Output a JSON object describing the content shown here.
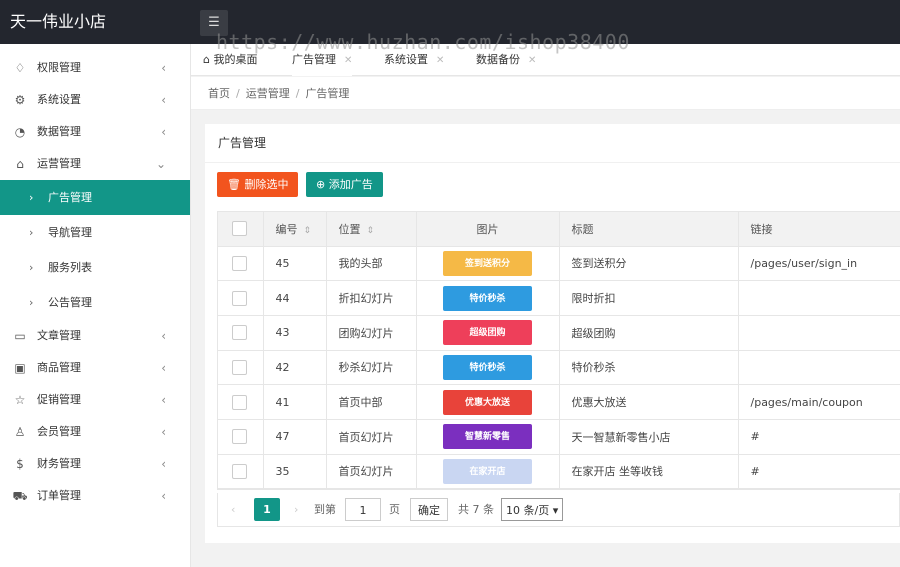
{
  "app": {
    "title": "天一伟业小店",
    "menu_icon": "hamburger-icon"
  },
  "watermark": "https://www.huzhan.com/ishop38400",
  "sidebar": {
    "items": [
      {
        "label": "权限管理",
        "icon": "permissions-icon",
        "glyph": "♢"
      },
      {
        "label": "系统设置",
        "icon": "gear-icon",
        "glyph": "⚙"
      },
      {
        "label": "数据管理",
        "icon": "chart-icon",
        "glyph": "◔"
      },
      {
        "label": "运营管理",
        "icon": "operations-icon",
        "glyph": "⌂",
        "expanded": true
      }
    ],
    "sub_items": [
      {
        "label": "广告管理",
        "active": true
      },
      {
        "label": "导航管理"
      },
      {
        "label": "服务列表"
      },
      {
        "label": "公告管理"
      }
    ],
    "items_after": [
      {
        "label": "文章管理",
        "icon": "book-icon",
        "glyph": "▭"
      },
      {
        "label": "商品管理",
        "icon": "box-icon",
        "glyph": "▣"
      },
      {
        "label": "促销管理",
        "icon": "star-icon",
        "glyph": "☆"
      },
      {
        "label": "会员管理",
        "icon": "user-icon",
        "glyph": "♙"
      },
      {
        "label": "财务管理",
        "icon": "dollar-icon",
        "glyph": "$"
      },
      {
        "label": "订单管理",
        "icon": "cart-icon",
        "glyph": "⛟"
      }
    ]
  },
  "tabs": [
    {
      "label": "我的桌面",
      "icon": "home-icon"
    },
    {
      "label": "广告管理",
      "active": true
    },
    {
      "label": "系统设置"
    },
    {
      "label": "数据备份"
    }
  ],
  "breadcrumb": [
    "首页",
    "运营管理",
    "广告管理"
  ],
  "card": {
    "title": "广告管理",
    "delete_button": "删除选中",
    "add_button": "添加广告"
  },
  "table": {
    "headers": [
      "编号",
      "位置",
      "图片",
      "标题",
      "链接"
    ],
    "rows": [
      {
        "id": "45",
        "position": "我的头部",
        "image_text": "签到送积分",
        "image_color": "#f5b946",
        "title": "签到送积分",
        "link": "/pages/user/sign_in"
      },
      {
        "id": "44",
        "position": "折扣幻灯片",
        "image_text": "特价秒杀",
        "image_color": "#2e9be0",
        "title": "限时折扣",
        "link": ""
      },
      {
        "id": "43",
        "position": "团购幻灯片",
        "image_text": "超级团购",
        "image_color": "#ee3f5a",
        "title": "超级团购",
        "link": ""
      },
      {
        "id": "42",
        "position": "秒杀幻灯片",
        "image_text": "特价秒杀",
        "image_color": "#2e9be0",
        "title": "特价秒杀",
        "link": ""
      },
      {
        "id": "41",
        "position": "首页中部",
        "image_text": "优惠大放送",
        "image_color": "#e8433a",
        "title": "优惠大放送",
        "link": "/pages/main/coupon"
      },
      {
        "id": "47",
        "position": "首页幻灯片",
        "image_text": "智慧新零售",
        "image_color": "#7b2fbf",
        "title": "天一智慧新零售小店",
        "link": "#"
      },
      {
        "id": "35",
        "position": "首页幻灯片",
        "image_text": "在家开店",
        "image_color": "#c9d6f2",
        "title": "在家开店 坐等收钱",
        "link": "#"
      }
    ]
  },
  "pager": {
    "prev": "‹",
    "current": "1",
    "next": "›",
    "goto_label": "到第",
    "goto_value": "1",
    "page_label": "页",
    "confirm": "确定",
    "total": "共 7 条",
    "per_page": "10 条/页"
  }
}
